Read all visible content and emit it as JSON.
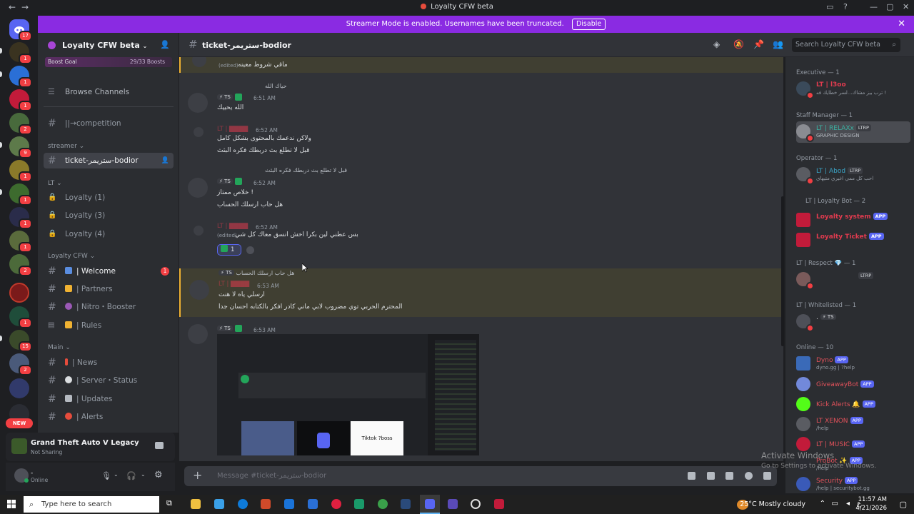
{
  "window": {
    "title": "Loyalty CFW beta",
    "back": "←",
    "forward": "→"
  },
  "banner": {
    "text": "Streamer Mode is enabled. Usernames have been truncated.",
    "button": "Disable"
  },
  "rail": {
    "badges": [
      "17",
      "1",
      "1",
      "1",
      "2",
      "9",
      "1",
      "1",
      "1",
      "1",
      "2",
      "1",
      "15",
      "2",
      "3"
    ],
    "new_label": "NEW"
  },
  "server": {
    "name": "Loyalty CFW beta",
    "boost_label": "Boost Goal",
    "boost_count": "29/33 Boosts",
    "browse": "Browse Channels"
  },
  "channels": {
    "competition": "||→competition",
    "cat_streamer": "streamer",
    "active": "ticket-ستريمر-bodior",
    "cat_lt": "LT",
    "loyalty": [
      "Loyalty (1)",
      "Loyalty (3)",
      "Loyalty (4)"
    ],
    "cat_loyalty": "Loyalty CFW",
    "welcome": "| Welcome",
    "welcome_badge": "1",
    "partners": "| Partners",
    "nitro": "| Nitro・Booster",
    "rules": "| Rules",
    "cat_main": "Main",
    "news": "| News",
    "status": "| Server・Status",
    "updates": "| Updates",
    "alerts": "| Alerts"
  },
  "game": {
    "title": "Grand Theft Auto V Legacy",
    "sub": "Not Sharing"
  },
  "user": {
    "name": "-",
    "status": "Online"
  },
  "header": {
    "channel": "ticket-ستريمر-bodior",
    "search": "Search Loyalty CFW beta"
  },
  "messages": {
    "m0": {
      "text": "ماقي شروط معينه",
      "edited": "(edited)"
    },
    "m1": {
      "reply": "حياك الله",
      "tag": "⚡ TS",
      "time": "6:51 AM",
      "text": "الله يحييك"
    },
    "m2": {
      "time": "6:52 AM",
      "l1": "ولاكن ندعمك بالمحتوى بشكل كامل",
      "l2": "قبل لا تطلع بث دربطك فكره البثث"
    },
    "m3": {
      "reply": "قبل لا تطلع بث دربطك فكره البثث",
      "tag": "⚡ TS",
      "time": "6:52 AM",
      "l1": "خلاص ممتاز !",
      "l2": "هل حاب ارسلك الحساب"
    },
    "m4": {
      "time": "6:52 AM",
      "edited": "(edited)",
      "text": "بس عطني لين بكرا اخش انسق معاك كل شي",
      "reaction": "1"
    },
    "m5": {
      "reply": "هل حاب ارسلك الحساب",
      "tag": "⚡ TS",
      "time": "6:53 AM",
      "l1": "ارسلي ياه لا هنت",
      "l2": "المحترم الحربي توي مضروب لابي ماني كادر افكر بالكتابه احسان جدا"
    },
    "m6": {
      "tag": "⚡ TS",
      "time": "6:53 AM",
      "img_label": "Tiktok ?boss"
    }
  },
  "composer": {
    "placeholder": "Message #ticket-ستريمر-bodior",
    "plus": "+"
  },
  "members": {
    "executive": "Executive — 1",
    "exec_name": "LT | l3oo",
    "exec_sub": "ترب بيز مشاك...لسر خطايك فه !",
    "staff": "Staff Manager — 1",
    "staff_name": "LT | RELAXx",
    "staff_sub": "GRAPHIC DESIGN",
    "ltrp": "LTRP",
    "operator": "Operator — 1",
    "op_name": "LT | Abod",
    "op_sub": "احب كل ممي اغيري متيهاي",
    "bots": "LT | Loyalty Bot — 2",
    "bot1": "Loyalty system",
    "bot2": "Loyalty Ticket",
    "app": "APP",
    "respect": "LT | Respect 💎 — 1",
    "whitelisted": "LT | Whitelisted — 1",
    "wl_name": "⚡ TS",
    "wl_prefix": ".",
    "online": "Online — 10",
    "on": [
      {
        "name": "Dyno",
        "sub": "dyno.gg | ?help",
        "color": "#e4525b"
      },
      {
        "name": "GiveawayBot",
        "sub": "",
        "color": "#e4525b"
      },
      {
        "name": "Kick Alerts 🔔",
        "sub": "",
        "color": "#e4525b"
      },
      {
        "name": "LT XENON",
        "sub": "/help",
        "color": "#e4525b"
      },
      {
        "name": "LT | MUSIC",
        "sub": "",
        "color": "#e4525b"
      },
      {
        "name": "ProBot ✨",
        "sub": "/help",
        "color": "#e4525b"
      },
      {
        "name": "Security",
        "sub": "/help | securitybot.gg",
        "color": "#e4525b"
      }
    ]
  },
  "watermark": {
    "l1": "Activate Windows",
    "l2": "Go to Settings to activate Windows."
  },
  "taskbar": {
    "search": "Type here to search",
    "weather": "25°C  Mostly cloudy",
    "time": "11:57 AM",
    "date": "4/21/2026"
  }
}
